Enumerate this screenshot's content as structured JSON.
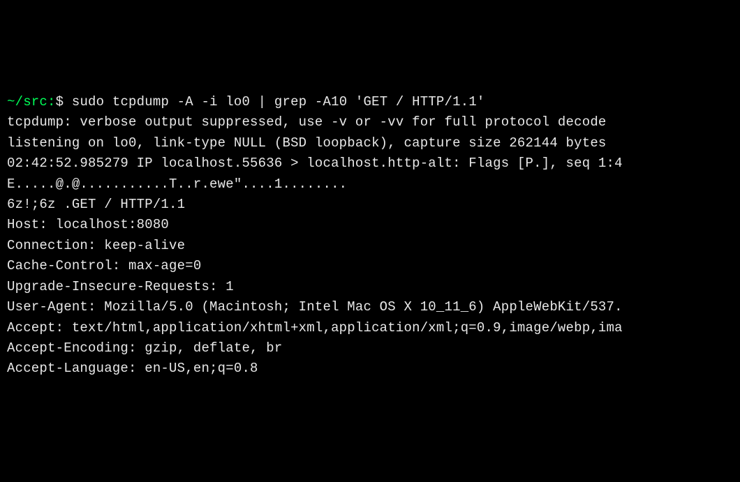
{
  "prompt": {
    "path": "~/src:",
    "dollar": "$",
    "command": "sudo tcpdump -A -i lo0 | grep -A10 'GET / HTTP/1.1'"
  },
  "output": {
    "lines": [
      "tcpdump: verbose output suppressed, use -v or -vv for full protocol decode",
      "listening on lo0, link-type NULL (BSD loopback), capture size 262144 bytes",
      "02:42:52.985279 IP localhost.55636 > localhost.http-alt: Flags [P.], seq 1:4",
      "E.....@.@...........T..r.ewe\"....1........",
      "6z!;6z .GET / HTTP/1.1",
      "Host: localhost:8080",
      "Connection: keep-alive",
      "Cache-Control: max-age=0",
      "Upgrade-Insecure-Requests: 1",
      "User-Agent: Mozilla/5.0 (Macintosh; Intel Mac OS X 10_11_6) AppleWebKit/537.",
      "Accept: text/html,application/xhtml+xml,application/xml;q=0.9,image/webp,ima",
      "Accept-Encoding: gzip, deflate, br",
      "Accept-Language: en-US,en;q=0.8"
    ]
  }
}
